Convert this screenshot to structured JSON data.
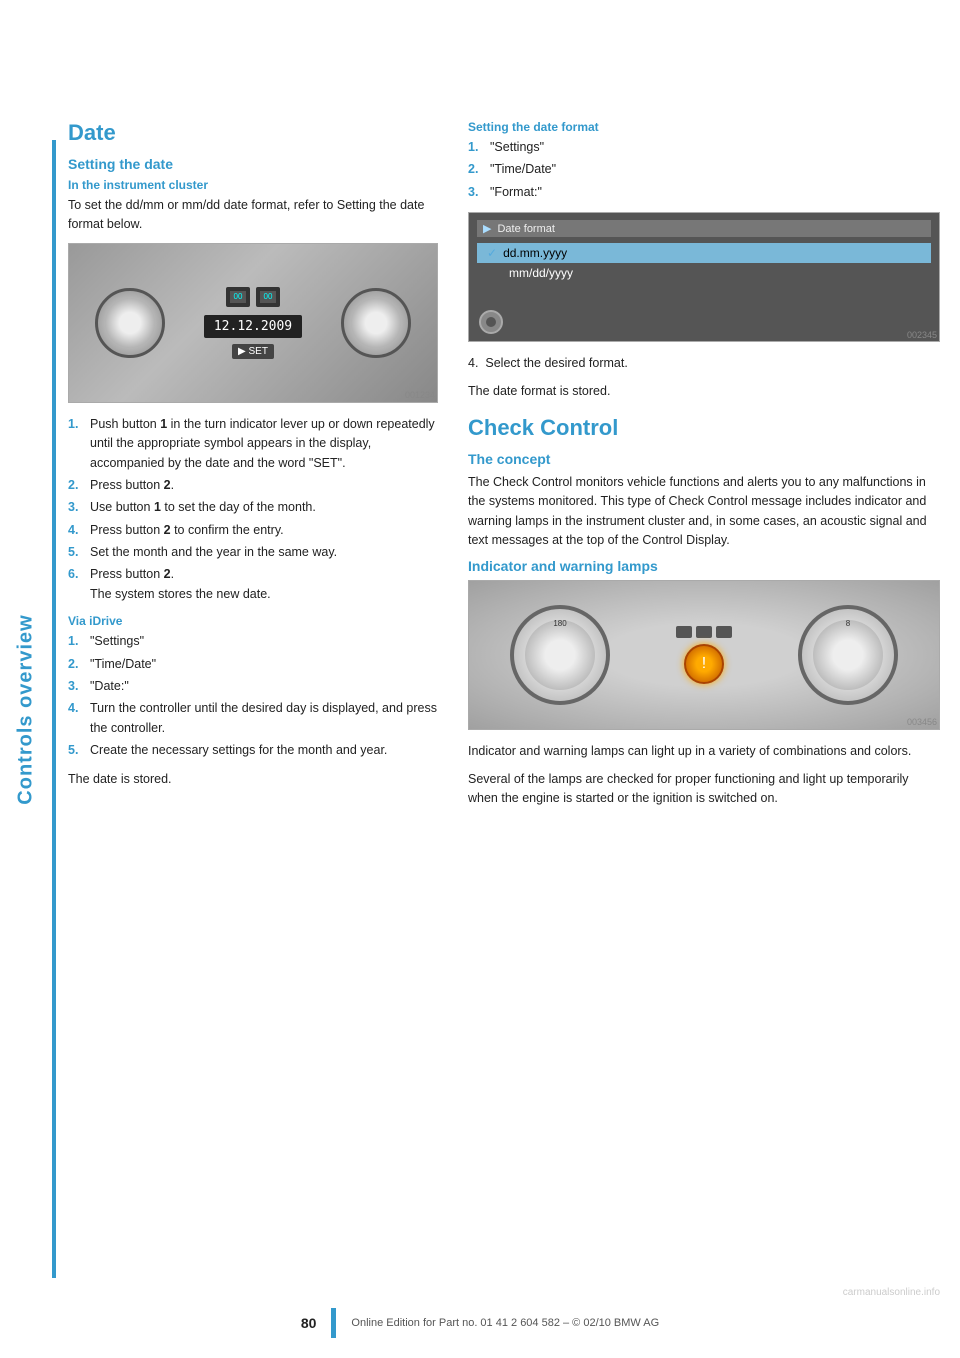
{
  "page": {
    "sidebar_label": "Controls overview",
    "page_number": "80",
    "footer_text": "Online Edition for Part no. 01 41 2 604 582 – © 02/10 BMW AG"
  },
  "left_col": {
    "section_title": "Date",
    "setting_date_title": "Setting the date",
    "instrument_cluster_subtitle": "In the instrument cluster",
    "instrument_cluster_body": "To set the dd/mm or mm/dd date format, refer to Setting the date format below.",
    "steps_cluster": [
      {
        "num": "1.",
        "text": "Push button 1 in the turn indicator lever up or down repeatedly until the appropriate symbol appears in the display, accompanied by the date and the word \"SET\"."
      },
      {
        "num": "2.",
        "text": "Press button 2."
      },
      {
        "num": "3.",
        "text": "Use button 1 to set the day of the month."
      },
      {
        "num": "4.",
        "text": "Press button 2 to confirm the entry."
      },
      {
        "num": "5.",
        "text": "Set the month and the year in the same way."
      },
      {
        "num": "6.",
        "text": "Press button 2. The system stores the new date."
      }
    ],
    "via_idrive_title": "Via iDrive",
    "steps_idrive": [
      {
        "num": "1.",
        "text": "\"Settings\""
      },
      {
        "num": "2.",
        "text": "\"Time/Date\""
      },
      {
        "num": "3.",
        "text": "\"Date:\""
      },
      {
        "num": "4.",
        "text": "Turn the controller until the desired day is displayed, and press the controller."
      },
      {
        "num": "5.",
        "text": "Create the necessary settings for the month and year."
      }
    ],
    "date_stored": "The date is stored.",
    "instrument_img_date": "12.12.2009",
    "instrument_img_set": "▶ SET"
  },
  "right_col": {
    "setting_date_format_title": "Setting the date format",
    "steps_format": [
      {
        "num": "1.",
        "text": "\"Settings\""
      },
      {
        "num": "2.",
        "text": "\"Time/Date\""
      },
      {
        "num": "3.",
        "text": "\"Format:\""
      }
    ],
    "step4": "Select the desired format.",
    "date_format_stored": "The date format is stored.",
    "date_format_screen": {
      "title": "Date format",
      "option1": "dd.mm.yyyy",
      "option2": "mm/dd/yyyy",
      "selected": "dd.mm.yyyy"
    },
    "check_control_title": "Check Control",
    "concept_title": "The concept",
    "concept_body": "The Check Control monitors vehicle functions and alerts you to any malfunctions in the systems monitored. This type of Check Control message includes indicator and warning lamps in the instrument cluster and, in some cases, an acoustic signal and text messages at the top of the Control Display.",
    "indicator_title": "Indicator and warning lamps",
    "indicator_body1": "Indicator and warning lamps can light up in a variety of combinations and colors.",
    "indicator_body2": "Several of the lamps are checked for proper functioning and light up temporarily when the engine is started or the ignition is switched on."
  }
}
